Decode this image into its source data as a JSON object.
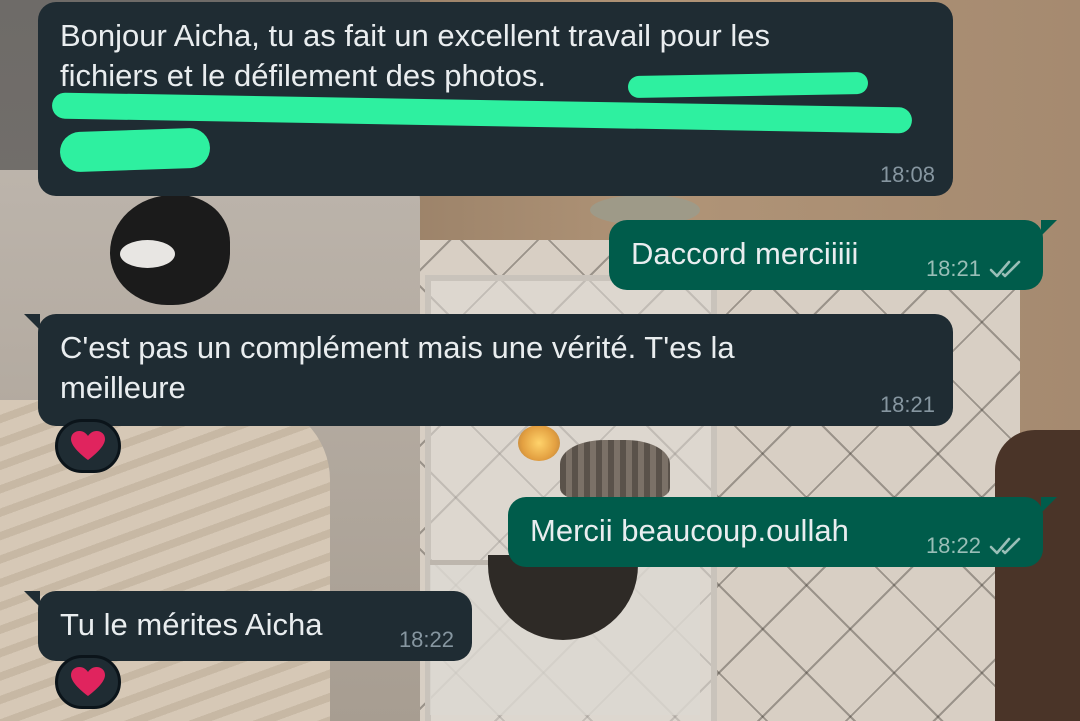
{
  "messages": [
    {
      "direction": "incoming",
      "text": "Bonjour Aicha, tu as fait un excellent travail pour les\nfichiers et le défilement des photos.",
      "time": "18:08",
      "redacted": true
    },
    {
      "direction": "outgoing",
      "text": "Daccord merciiiii",
      "time": "18:21",
      "status": "read"
    },
    {
      "direction": "incoming",
      "text": "C'est pas un complément mais une vérité. T'es la\nmeilleure",
      "time": "18:21",
      "reaction": "heart"
    },
    {
      "direction": "outgoing",
      "text": "Mercii beaucoup.oullah",
      "time": "18:22",
      "status": "read"
    },
    {
      "direction": "incoming",
      "text": "Tu le mérites Aicha",
      "time": "18:22",
      "reaction": "heart"
    }
  ],
  "colors": {
    "incoming_bubble": "#1f2c33",
    "outgoing_bubble": "#005c4b",
    "message_text": "#e9edef",
    "timestamp": "#8696a0",
    "redaction": "#2ef0a0",
    "reaction_heart": "#e0245e"
  },
  "icons": {
    "read_receipt": "double-check-icon",
    "reaction": "heart-icon"
  }
}
